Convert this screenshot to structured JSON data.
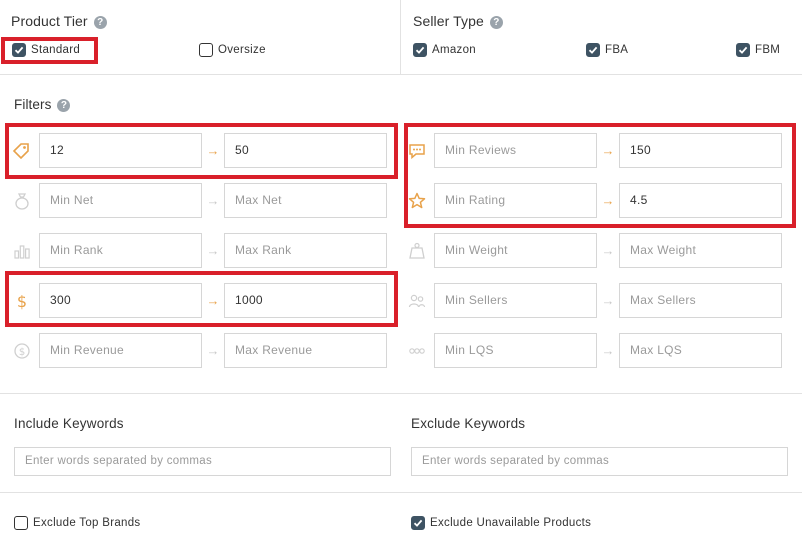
{
  "product_tier": {
    "title": "Product Tier",
    "options": [
      {
        "label": "Standard",
        "checked": true
      },
      {
        "label": "Oversize",
        "checked": false
      }
    ]
  },
  "seller_type": {
    "title": "Seller Type",
    "options": [
      {
        "label": "Amazon",
        "checked": true
      },
      {
        "label": "FBA",
        "checked": true
      },
      {
        "label": "FBM",
        "checked": true
      }
    ]
  },
  "filters": {
    "title": "Filters",
    "left": [
      {
        "icon": "price-tag-icon",
        "min_value": "12",
        "max_value": "50",
        "active": true
      },
      {
        "icon": "money-bag-icon",
        "min_placeholder": "Min Net",
        "max_placeholder": "Max Net",
        "active": false
      },
      {
        "icon": "bar-chart-icon",
        "min_placeholder": "Min Rank",
        "max_placeholder": "Max Rank",
        "active": false
      },
      {
        "icon": "dollar-icon",
        "min_value": "300",
        "max_value": "1000",
        "active": true
      },
      {
        "icon": "revenue-coin-icon",
        "min_placeholder": "Min Revenue",
        "max_placeholder": "Max Revenue",
        "active": false
      }
    ],
    "right": [
      {
        "icon": "reviews-chat-icon",
        "min_placeholder": "Min Reviews",
        "max_value": "150",
        "active": true
      },
      {
        "icon": "star-icon",
        "min_placeholder": "Min Rating",
        "max_value": "4.5",
        "active": true
      },
      {
        "icon": "weight-icon",
        "min_placeholder": "Min Weight",
        "max_placeholder": "Max Weight",
        "active": false
      },
      {
        "icon": "sellers-icon",
        "min_placeholder": "Min Sellers",
        "max_placeholder": "Max Sellers",
        "active": false
      },
      {
        "icon": "lqs-icon",
        "min_placeholder": "Min LQS",
        "max_placeholder": "Max LQS",
        "active": false
      }
    ],
    "arrow_glyph": "→"
  },
  "keywords": {
    "include_label": "Include Keywords",
    "include_placeholder": "Enter words separated by commas",
    "exclude_label": "Exclude Keywords",
    "exclude_placeholder": "Enter words separated by commas"
  },
  "bottom": {
    "exclude_top_brands": {
      "label": "Exclude Top Brands",
      "checked": false
    },
    "exclude_unavailable": {
      "label": "Exclude Unavailable Products",
      "checked": true
    }
  },
  "colors": {
    "accent": "#e8a24a",
    "checkbox_fill": "#3e5363",
    "highlight_red": "#d9202a",
    "border": "#d6d6d6",
    "placeholder": "#9a9a9a"
  }
}
